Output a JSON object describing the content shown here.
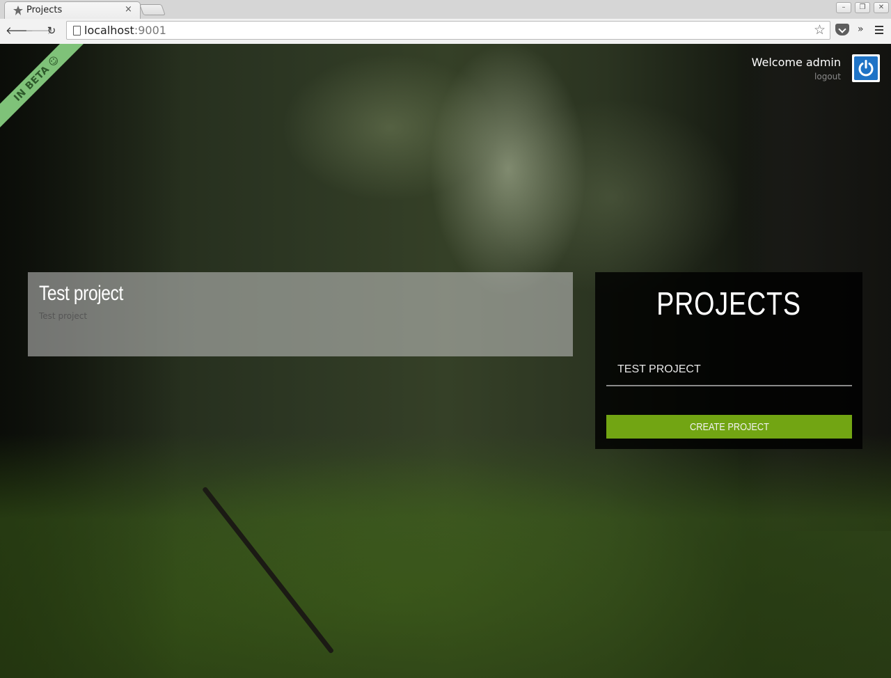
{
  "browser": {
    "tab_title": "Projects",
    "tab_close": "×",
    "url_host": "localhost",
    "url_port": ":9001",
    "window_buttons": [
      "–",
      "❐",
      "✕"
    ],
    "overflow_label": "»"
  },
  "ribbon": {
    "label": "IN BETA ☺"
  },
  "user": {
    "welcome_text": "Welcome admin",
    "logout_label": "logout"
  },
  "projects": {
    "items": [
      {
        "name": "Test project",
        "description": "Test project"
      }
    ]
  },
  "panel": {
    "title": "PROJECTS",
    "input_value": "TEST PROJECT",
    "create_button_label": "CREATE PROJECT"
  },
  "colors": {
    "accent_green": "#72a513",
    "ribbon_green": "#7fc279",
    "power_blue": "#1f73c6"
  }
}
